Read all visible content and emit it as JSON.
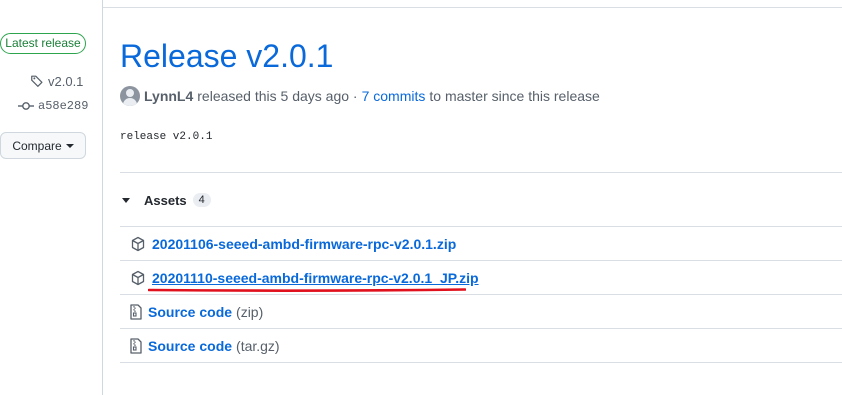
{
  "sidebar": {
    "badge": "Latest release",
    "tag": "v2.0.1",
    "commit": "a58e289",
    "compare_label": "Compare"
  },
  "release": {
    "title": "Release v2.0.1",
    "author": "LynnL4",
    "released_text": "released this 5 days ago ·",
    "commits_link": "7 commits",
    "target_text": "to master since this release",
    "notes": "release v2.0.1"
  },
  "assets": {
    "heading": "Assets",
    "count": "4",
    "items": [
      {
        "name": "20201106-seeed-ambd-firmware-rpc-v2.0.1.zip",
        "ext": "",
        "icon": "package-icon"
      },
      {
        "name": "20201110-seeed-ambd-firmware-rpc-v2.0.1_JP.zip",
        "ext": "",
        "icon": "package-icon"
      },
      {
        "name": "Source code",
        "ext": "(zip)",
        "icon": "file-zip-icon"
      },
      {
        "name": "Source code",
        "ext": "(tar.gz)",
        "icon": "file-zip-icon"
      }
    ]
  },
  "colors": {
    "link": "#0969da",
    "badge": "#1a7f37",
    "annotation": "#e0101c"
  }
}
